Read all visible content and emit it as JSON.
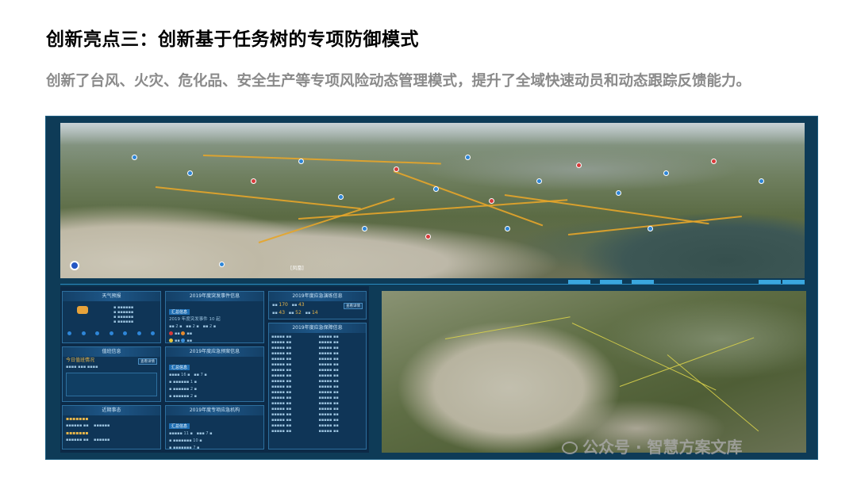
{
  "title": "创新亮点三：创新基于任务树的专项防御模式",
  "subtitle": "创新了台风、火灾、危化品、安全生产等专项风险动态管理模式，提升了全域快速动员和动态跟踪反馈能力。",
  "screenshot": {
    "top_map": {
      "label": "[凤凰]"
    },
    "panels": [
      {
        "title": "天气预报"
      },
      {
        "title": "2019年度突发事件信息",
        "tag": "汇总信息",
        "line": "2019 年度突发事件 10 起"
      },
      {
        "title": "2019年度应急演练信息",
        "numbers": [
          "170",
          "43",
          "43",
          "52",
          "14"
        ]
      },
      {
        "title": "值班信息",
        "tag": "今日值班情况"
      },
      {
        "title": "2019年度应急预案信息",
        "tag": "汇总信息"
      },
      {
        "title": "2019年度应急保障信息"
      },
      {
        "title": "近期事态"
      },
      {
        "title": "2019年度专项应急机构",
        "tag": "汇总信息"
      }
    ],
    "buttons": {
      "more": "查看详情"
    }
  },
  "watermark": "公众号 · 智慧方案文库",
  "colors": {
    "frame": "#0e3b57",
    "panel": "#0f3557",
    "accent": "#3aa7df",
    "road": "#e6a52a"
  }
}
